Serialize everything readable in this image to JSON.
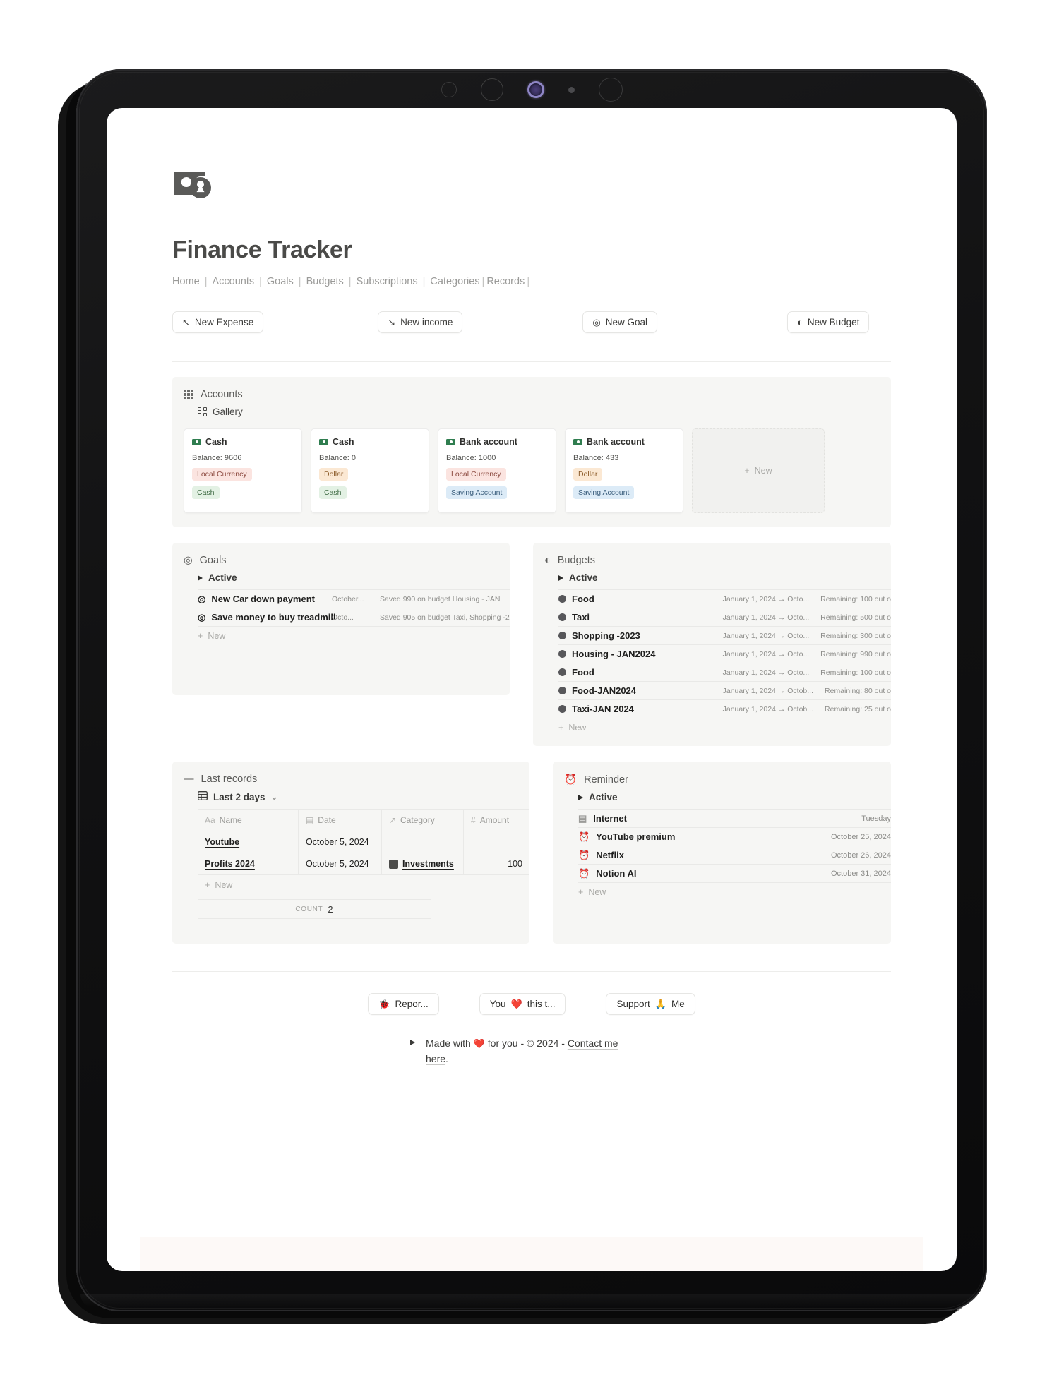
{
  "app": {
    "title": "Finance Tracker",
    "cover_icon": "money-cash-icon"
  },
  "nav": {
    "items": [
      {
        "label": "Home"
      },
      {
        "label": "Accounts"
      },
      {
        "label": "Goals"
      },
      {
        "label": "Budgets"
      },
      {
        "label": "Subscriptions"
      },
      {
        "label": "Categories"
      },
      {
        "label": "Records"
      }
    ],
    "separator": "|"
  },
  "actions": [
    {
      "label": "New Expense",
      "icon": "arrow-up-left-icon",
      "glyph": "↖"
    },
    {
      "label": "New income",
      "icon": "arrow-down-right-icon",
      "glyph": "↘"
    },
    {
      "label": "New Goal",
      "icon": "target-icon",
      "glyph": "◎"
    },
    {
      "label": "New Budget",
      "icon": "half-circle-icon",
      "glyph": "◐"
    }
  ],
  "accounts": {
    "title": "Accounts",
    "view": "Gallery",
    "view_icon": "gallery-icon",
    "section_icon": "grid-icon",
    "new_label": "New",
    "cards": [
      {
        "name": "Cash",
        "balance": "Balance: 9606",
        "tag1": "Local Currency",
        "tag2": "Cash",
        "tag1_color": "pink",
        "tag2_color": "green"
      },
      {
        "name": "Cash",
        "balance": "Balance: 0",
        "tag1": "Dollar",
        "tag2": "Cash",
        "tag1_color": "orange",
        "tag2_color": "green"
      },
      {
        "name": "Bank account",
        "balance": "Balance: 1000",
        "tag1": "Local Currency",
        "tag2": "Saving Account",
        "tag1_color": "pink",
        "tag2_color": "blue"
      },
      {
        "name": "Bank account",
        "balance": "Balance: 433",
        "tag1": "Dollar",
        "tag2": "Saving Account",
        "tag1_color": "orange",
        "tag2_color": "blue"
      }
    ]
  },
  "goals": {
    "title": "Goals",
    "section_icon": "target-icon",
    "group": "Active",
    "new_label": "New",
    "rows": [
      {
        "name": "New Car down payment",
        "date": "October...",
        "note": "Saved 990 on budget Housing - JAN",
        "icon": "target-icon"
      },
      {
        "name": "Save money to buy treadmill",
        "date": "Octo...",
        "note": "Saved 905 on budget Taxi, Shopping -2",
        "icon": "target-icon"
      }
    ]
  },
  "budgets": {
    "title": "Budgets",
    "section_icon": "half-circle-icon",
    "group": "Active",
    "new_label": "New",
    "rows": [
      {
        "name": "Food",
        "range": "January 1, 2024 → Octo...",
        "remaining": "Remaining: 100 out o"
      },
      {
        "name": "Taxi",
        "range": "January 1, 2024 → Octo...",
        "remaining": "Remaining: 500 out o"
      },
      {
        "name": "Shopping -2023",
        "range": "January 1, 2024 → Octo...",
        "remaining": "Remaining: 300 out o"
      },
      {
        "name": "Housing - JAN2024",
        "range": "January 1, 2024 → Octo...",
        "remaining": "Remaining: 990 out o"
      },
      {
        "name": "Food",
        "range": "January 1, 2024 → Octo...",
        "remaining": "Remaining: 100 out o"
      },
      {
        "name": "Food-JAN2024",
        "range": "January 1, 2024 → Octob...",
        "remaining": "Remaining: 80 out o"
      },
      {
        "name": "Taxi-JAN 2024",
        "range": "January 1, 2024 → Octob...",
        "remaining": "Remaining: 25 out o"
      }
    ]
  },
  "records": {
    "title": "Last records",
    "section_icon": "minus-icon",
    "view": "Last 2 days",
    "view_icon": "table-icon",
    "chevron": "⌄",
    "new_label": "New",
    "columns": [
      {
        "label": "Name",
        "type_icon": "Aa"
      },
      {
        "label": "Date",
        "type_icon": "calendar-icon"
      },
      {
        "label": "Category",
        "type_icon": "↗"
      },
      {
        "label": "Amount",
        "type_icon": "#"
      }
    ],
    "rows": [
      {
        "name": "Youtube",
        "date": "October 5, 2024",
        "category": "",
        "amount": ""
      },
      {
        "name": "Profits 2024",
        "date": "October 5, 2024",
        "category": "Investments",
        "amount": "100"
      }
    ],
    "count_label": "COUNT",
    "count_value": "2"
  },
  "reminder": {
    "title": "Reminder",
    "section_icon": "alarm-clock-icon",
    "group": "Active",
    "new_label": "New",
    "rows": [
      {
        "name": "Internet",
        "date": "Tuesday",
        "icon": "page-icon"
      },
      {
        "name": "YouTube premium",
        "date": "October 25, 2024",
        "icon": "alarm-clock-icon"
      },
      {
        "name": "Netflix",
        "date": "October 26, 2024",
        "icon": "alarm-clock-icon"
      },
      {
        "name": "Notion AI",
        "date": "October 31, 2024",
        "icon": "alarm-clock-icon"
      }
    ]
  },
  "footer": {
    "buttons": [
      {
        "label": "Repor...",
        "emoji": "🐞",
        "icon": "bug-icon"
      },
      {
        "label_before": "You",
        "emoji": "❤️",
        "label_after": "this t...",
        "icon": "heart-icon"
      },
      {
        "label_before": "Support",
        "emoji": "🙏",
        "label_after": "Me",
        "icon": "pray-icon"
      }
    ],
    "credit_prefix": "Made with",
    "credit_emoji": "❤️",
    "credit_middle": "for you -",
    "credit_copyright": "©",
    "credit_year": "2024 -",
    "credit_link": "Contact me here",
    "credit_end": "."
  },
  "device": {
    "sensors": [
      "ring-small",
      "ring-medium",
      "camera-lens",
      "dot",
      "ring-large"
    ]
  },
  "colors": {
    "accent_green": "#2f7d4f",
    "panel_bg": "#f6f6f4",
    "text_primary": "#1f1f1e",
    "text_muted": "#8e8e8b",
    "bezel": "#121213"
  }
}
